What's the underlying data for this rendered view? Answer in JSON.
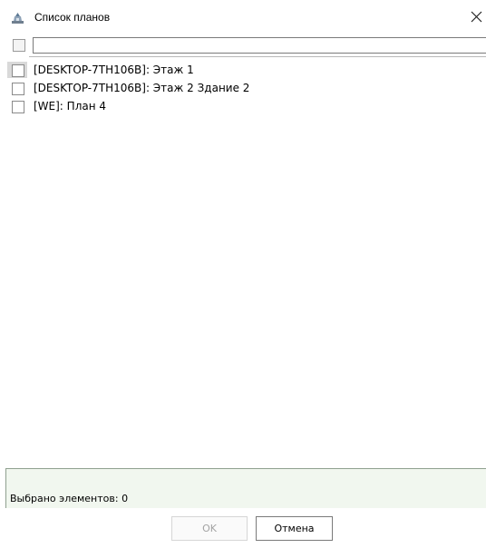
{
  "window": {
    "title": "Список планов",
    "icon": "plan-map-icon",
    "close_icon": "close-icon"
  },
  "filter": {
    "value": "",
    "placeholder": ""
  },
  "plans": [
    {
      "label": "[DESKTOP-7TH106B]: Этаж 1",
      "checked": false
    },
    {
      "label": "[DESKTOP-7TH106B]: Этаж 2 Здание 2",
      "checked": false
    },
    {
      "label": "[WE]: План 4",
      "checked": false
    }
  ],
  "status": {
    "selected_text": "Выбрано элементов: 0"
  },
  "buttons": {
    "ok_label": "OK",
    "cancel_label": "Отмена"
  }
}
